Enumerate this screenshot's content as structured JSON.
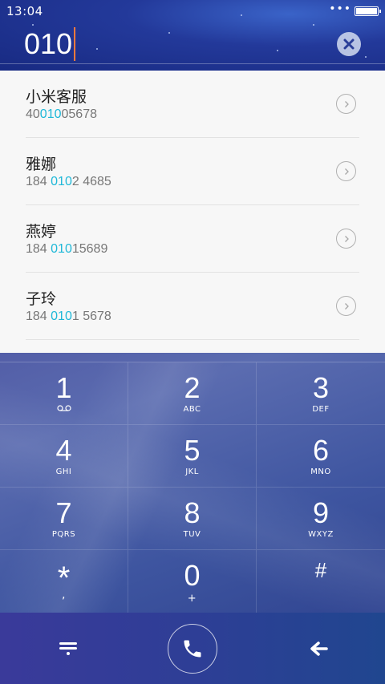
{
  "status": {
    "time": "13:04",
    "dots": "•••"
  },
  "dialer": {
    "input": "010"
  },
  "contacts": [
    {
      "name": "小米客服",
      "num_pre": "40",
      "num_hl": "010",
      "num_post": "05678"
    },
    {
      "name": "雅娜",
      "num_pre": "184 ",
      "num_hl": "010",
      "num_post": "2 4685"
    },
    {
      "name": "燕婷",
      "num_pre": "184 ",
      "num_hl": "010",
      "num_post": "15689"
    },
    {
      "name": "子玲",
      "num_pre": "184 ",
      "num_hl": "010",
      "num_post": "1 5678"
    }
  ],
  "keys": [
    {
      "digit": "1",
      "letters": ""
    },
    {
      "digit": "2",
      "letters": "ABC"
    },
    {
      "digit": "3",
      "letters": "DEF"
    },
    {
      "digit": "4",
      "letters": "GHI"
    },
    {
      "digit": "5",
      "letters": "JKL"
    },
    {
      "digit": "6",
      "letters": "MNO"
    },
    {
      "digit": "7",
      "letters": "PQRS"
    },
    {
      "digit": "8",
      "letters": "TUV"
    },
    {
      "digit": "9",
      "letters": "WXYZ"
    },
    {
      "digit": "*",
      "letters": ","
    },
    {
      "digit": "0",
      "letters": "+"
    },
    {
      "digit": "#",
      "letters": ""
    }
  ],
  "icons": {
    "voicemail": "voicemail-icon",
    "clear": "clear-icon",
    "detail": "chevron-right-icon",
    "menu": "menu-icon",
    "call": "phone-icon",
    "back": "backspace-arrow-icon"
  },
  "colors": {
    "highlight": "#1fb8d8",
    "caret": "#ff7a3c"
  }
}
